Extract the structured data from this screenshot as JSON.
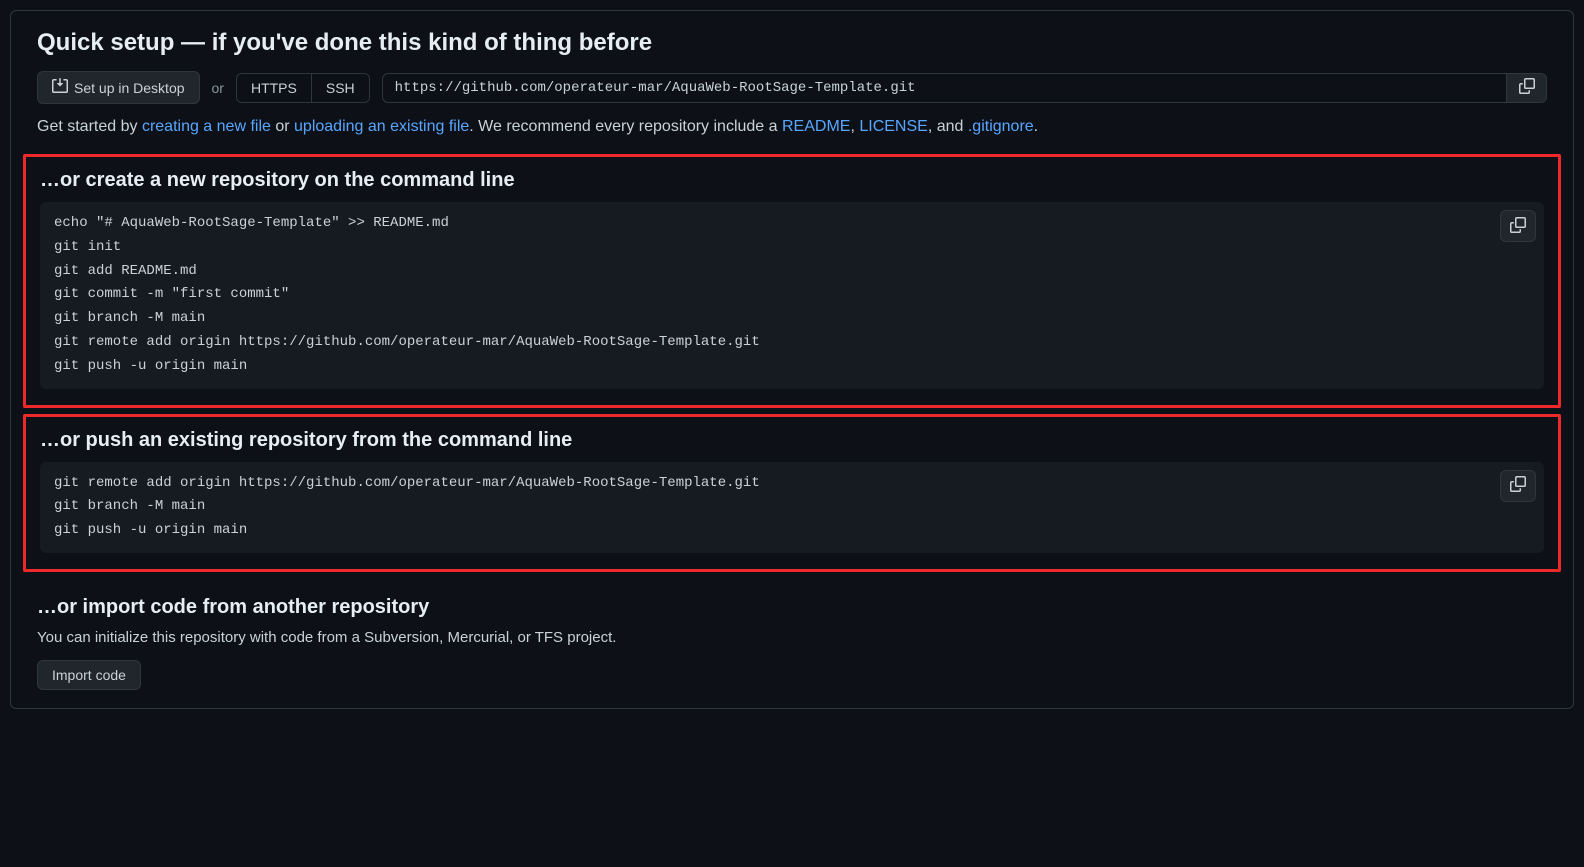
{
  "header": {
    "title": "Quick setup — if you've done this kind of thing before",
    "setup_desktop": "Set up in Desktop",
    "or": "or",
    "protocol_https": "HTTPS",
    "protocol_ssh": "SSH",
    "repo_url": "https://github.com/operateur-mar/AquaWeb-RootSage-Template.git"
  },
  "get_started": {
    "prefix": "Get started by ",
    "link_new_file": "creating a new file",
    "or": " or ",
    "link_upload": "uploading an existing file",
    "mid": ". We recommend every repository include a ",
    "readme": "README",
    "comma": ", ",
    "license": "LICENSE",
    "and": ", and ",
    "gitignore": ".gitignore",
    "end": "."
  },
  "create_section": {
    "title": "…or create a new repository on the command line",
    "code": "echo \"# AquaWeb-RootSage-Template\" >> README.md\ngit init\ngit add README.md\ngit commit -m \"first commit\"\ngit branch -M main\ngit remote add origin https://github.com/operateur-mar/AquaWeb-RootSage-Template.git\ngit push -u origin main"
  },
  "push_section": {
    "title": "…or push an existing repository from the command line",
    "code": "git remote add origin https://github.com/operateur-mar/AquaWeb-RootSage-Template.git\ngit branch -M main\ngit push -u origin main"
  },
  "import_section": {
    "title": "…or import code from another repository",
    "subtext": "You can initialize this repository with code from a Subversion, Mercurial, or TFS project.",
    "button": "Import code"
  }
}
